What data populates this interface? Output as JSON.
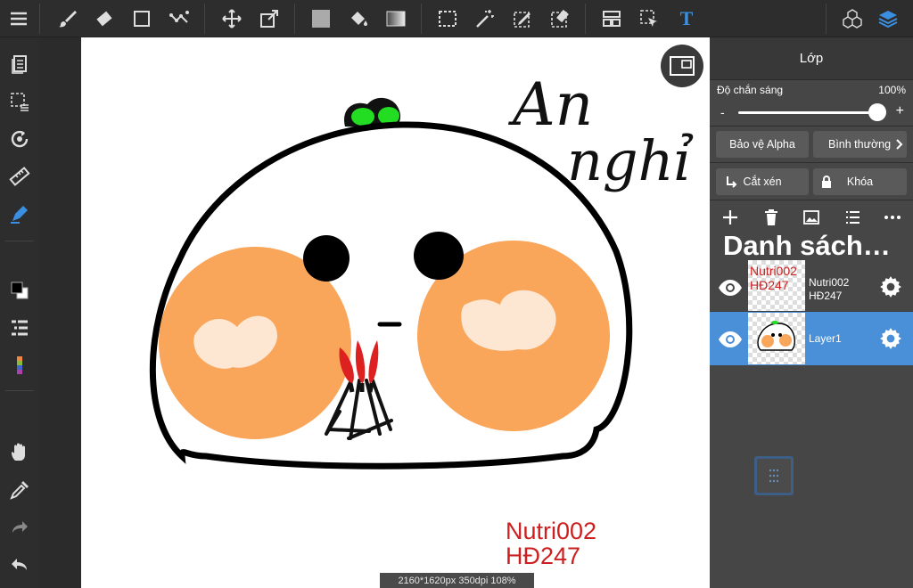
{
  "toolbar": {
    "icons": [
      "menu-icon",
      "brush-icon",
      "eraser-icon",
      "rectangle-icon",
      "dots-icon",
      "move-icon",
      "transform-icon",
      "fill-color-icon",
      "bucket-icon",
      "gradient-icon",
      "select-rect-icon",
      "magic-wand-icon",
      "select-pen-icon",
      "select-eraser-icon",
      "panel-icon",
      "select-layer-icon",
      "text-icon",
      "materials-icon",
      "layers-icon"
    ],
    "text_tool_glyph": "T"
  },
  "left_tools": [
    "page-manager-icon",
    "deselect-icon",
    "rotate-icon",
    "ruler-icon",
    "pen-snap-icon",
    "color-swatch-icon",
    "layer-list-icon",
    "color-picker-icon",
    "hand-icon",
    "eyedropper-icon",
    "redo-icon",
    "undo-icon"
  ],
  "canvas": {
    "handwriting_line1": "An",
    "handwriting_line2": "nghỉ",
    "watermark_line1": "Nutri002",
    "watermark_line2": "HĐ247",
    "status": "2160*1620px 350dpi 108%"
  },
  "panel": {
    "title": "Lớp",
    "opacity_label": "Độ chắn sáng",
    "opacity_value": "100%",
    "opacity_fraction": 1.0,
    "minus": "-",
    "plus": "+",
    "alpha_protect": "Bảo vệ Alpha",
    "blend_mode": "Bình thường",
    "clipping": "Cắt xén",
    "lock": "Khóa",
    "layer_list_header": "Danh sách…",
    "layers": [
      {
        "name_line1": "Nutri002",
        "name_line2": "HĐ247",
        "thumb_line1": "Nutri002",
        "thumb_line2": "HĐ247",
        "selected": false
      },
      {
        "name_line1": "Layer1",
        "name_line2": "",
        "selected": true
      }
    ]
  },
  "colors": {
    "accent": "#4a90d9",
    "cheek": "#f9a65a",
    "cheek_highlight": "#fde6d2",
    "sprout": "#22dd22",
    "watermark": "#cc1f1f",
    "incense": "#dd2020"
  }
}
